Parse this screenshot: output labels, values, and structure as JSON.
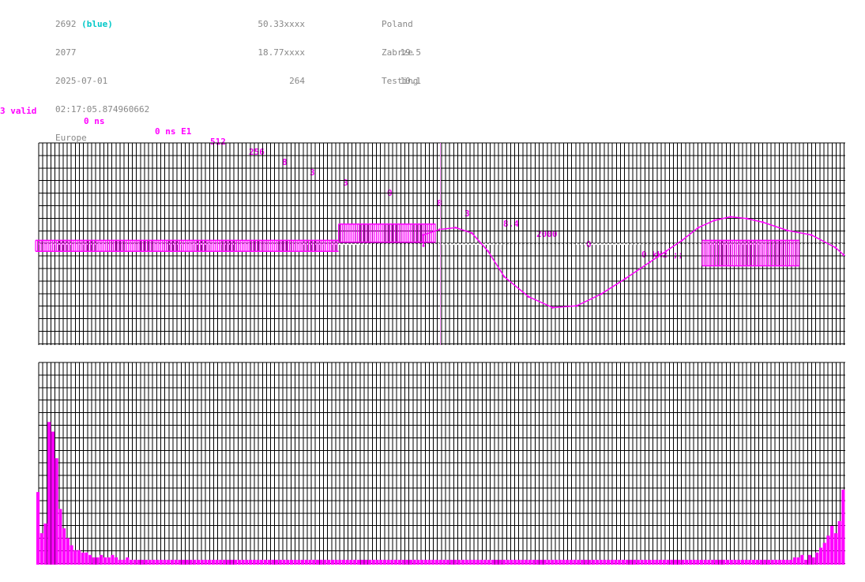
{
  "header": {
    "col1": {
      "id": "2692",
      "color_tag": "(blue)",
      "line2": "2077",
      "date": "2025-07-01",
      "time": "02:17:05.874960662",
      "region": "Europe"
    },
    "col2": {
      "lat": "50.33xxxx",
      "lon": "18.77xxxx",
      "count": "264"
    },
    "col3": {
      "country": "Poland",
      "city": "Zabrze",
      "mode": "Testing",
      "v1": "19.5",
      "v2": "10.1"
    }
  },
  "params": {
    "valid": "3 valid",
    "t1": "0 ns",
    "t2": "0 ns E1",
    "p1": "512",
    "p2": "256",
    "p3": "8",
    "p4": "3",
    "p5": "3",
    "p6": "0",
    "p7": "8",
    "p8": "3",
    "p9": "8.4",
    "p10": "2000",
    "p11": "0",
    "freq": "0 kHz ;;"
  },
  "colors": {
    "trace": "#ff00ff",
    "grid": "#000000",
    "header_text": "#888888",
    "accent": "#00c8c8"
  },
  "chart_data": [
    {
      "type": "line",
      "title": "",
      "grid": true,
      "x": [
        0,
        20,
        40,
        60,
        80,
        96,
        100,
        104,
        108,
        112,
        116,
        122,
        128,
        134,
        140,
        146,
        152,
        156,
        160,
        164,
        168,
        172,
        176,
        180,
        186,
        192,
        198,
        200
      ],
      "values": [
        -2,
        -2,
        -2,
        -2,
        -2,
        -2,
        10,
        16,
        18,
        12,
        -8,
        -36,
        -58,
        -70,
        -68,
        -55,
        -38,
        -20,
        -8,
        4,
        18,
        26,
        30,
        28,
        24,
        15,
        10,
        -4,
        -12
      ],
      "segments": [
        {
          "x0": 0,
          "x1": 75,
          "level": -2,
          "band": 6
        },
        {
          "x0": 75,
          "x1": 99,
          "level": 12,
          "band": 10
        },
        {
          "x0": 165,
          "x1": 189,
          "level": -10,
          "band": 14
        }
      ],
      "cursor_x": 100
    },
    {
      "type": "bar",
      "title": "",
      "grid": true,
      "values": [
        60,
        26,
        34,
        118,
        110,
        88,
        46,
        30,
        22,
        16,
        12,
        12,
        10,
        10,
        8,
        6,
        6,
        8,
        6,
        6,
        8,
        6,
        4,
        4,
        6,
        4,
        4,
        4,
        4,
        4,
        4,
        4,
        4,
        4,
        4,
        4,
        4,
        4,
        4,
        4,
        4,
        4,
        4,
        4,
        4,
        4,
        4,
        4,
        4,
        4,
        4,
        4,
        4,
        4,
        4,
        4,
        4,
        4,
        4,
        4,
        4,
        4,
        4,
        4,
        4,
        4,
        4,
        4,
        4,
        4,
        4,
        4,
        4,
        4,
        4,
        4,
        4,
        4,
        4,
        4,
        4,
        4,
        4,
        4,
        4,
        4,
        4,
        4,
        4,
        4,
        4,
        4,
        4,
        4,
        4,
        4,
        4,
        4,
        4,
        4,
        4,
        4,
        4,
        4,
        4,
        4,
        4,
        4,
        4,
        4,
        4,
        4,
        4,
        4,
        4,
        4,
        4,
        4,
        4,
        4,
        4,
        4,
        4,
        4,
        4,
        4,
        4,
        4,
        4,
        4,
        4,
        4,
        4,
        4,
        4,
        4,
        4,
        4,
        4,
        4,
        4,
        4,
        4,
        4,
        4,
        4,
        4,
        4,
        4,
        4,
        4,
        4,
        4,
        4,
        4,
        4,
        4,
        4,
        4,
        4,
        4,
        4,
        4,
        4,
        4,
        4,
        4,
        4,
        4,
        4,
        4,
        4,
        4,
        4,
        4,
        4,
        4,
        4,
        4,
        4,
        4,
        4,
        4,
        4,
        4,
        4,
        4,
        4,
        4,
        4,
        4,
        4,
        4,
        4,
        4,
        4,
        4,
        4,
        4,
        4,
        4,
        4,
        4,
        6,
        6,
        8,
        4,
        8,
        6,
        10,
        14,
        18,
        24,
        32,
        26,
        36,
        62
      ],
      "ylim": [
        0,
        160
      ]
    }
  ]
}
